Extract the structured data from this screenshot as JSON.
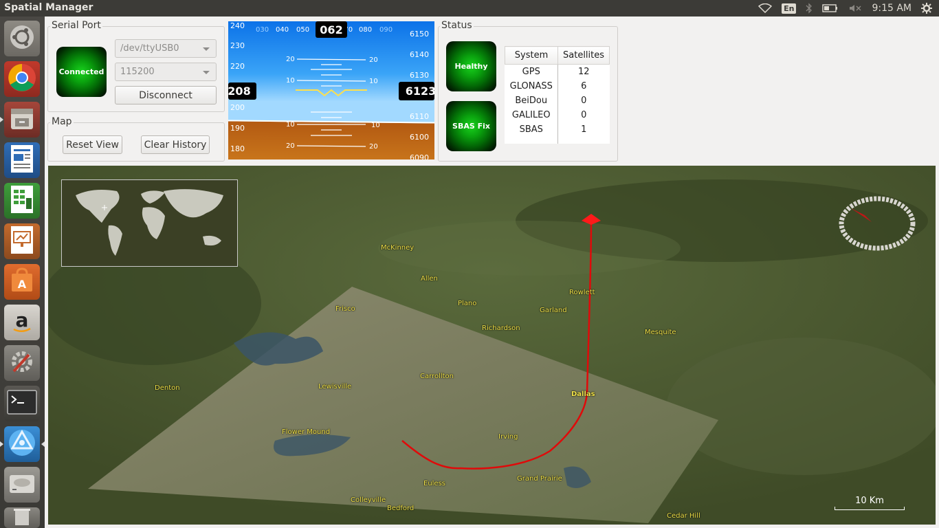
{
  "window": {
    "title": "Spatial Manager"
  },
  "tray": {
    "language": "En",
    "clock": "9:15 AM"
  },
  "launcher": [
    "dash-icon",
    "chrome-icon",
    "files-icon",
    "writer-icon",
    "calc-icon",
    "impress-icon",
    "software-center-icon",
    "amazon-icon",
    "system-settings-icon",
    "terminal-icon",
    "spatial-manager-icon",
    "disk-icon",
    "trash-icon"
  ],
  "serial": {
    "legend": "Serial Port",
    "status": "Connected",
    "port": "/dev/ttyUSB0",
    "baud": "115200",
    "disconnect_label": "Disconnect"
  },
  "map_panel": {
    "legend": "Map",
    "reset_label": "Reset View",
    "clear_label": "Clear History"
  },
  "pfd": {
    "heading": "062",
    "heading_ticks": [
      "030",
      "040",
      "050",
      "070",
      "080",
      "090"
    ],
    "speed": "208",
    "speed_ticks": [
      "240",
      "230",
      "220",
      "200",
      "190",
      "180"
    ],
    "altitude": "6123",
    "altitude_ticks": [
      "6150",
      "6140",
      "6130",
      "6110",
      "6100",
      "6090"
    ],
    "pitch_labels": [
      "20",
      "10",
      "10",
      "20"
    ]
  },
  "status": {
    "legend": "Status",
    "health": "Healthy",
    "fix": "SBAS Fix",
    "table": {
      "headers": [
        "System",
        "Satellites"
      ],
      "rows": [
        {
          "system": "GPS",
          "count": "12"
        },
        {
          "system": "GLONASS",
          "count": "6"
        },
        {
          "system": "BeiDou",
          "count": "0"
        },
        {
          "system": "GALILEO",
          "count": "0"
        },
        {
          "system": "SBAS",
          "count": "1"
        }
      ]
    }
  },
  "map": {
    "labels": {
      "mckinney": "McKinney",
      "allen": "Allen",
      "plano": "Plano",
      "frisco": "Frisco",
      "rowlett": "Rowlett",
      "garland": "Garland",
      "richardson": "Richardson",
      "mesquite": "Mesquite",
      "denton": "Denton",
      "lewisville": "Lewisville",
      "carrollton": "Carrollton",
      "dallas": "Dallas",
      "flower_mound": "Flower Mound",
      "irving": "Irving",
      "grand_prairie": "Grand Prairie",
      "euless": "Euless",
      "colleyville": "Colleyville",
      "bedford": "Bedford",
      "cedar_hill": "Cedar Hill"
    },
    "scale": "10 Km"
  }
}
